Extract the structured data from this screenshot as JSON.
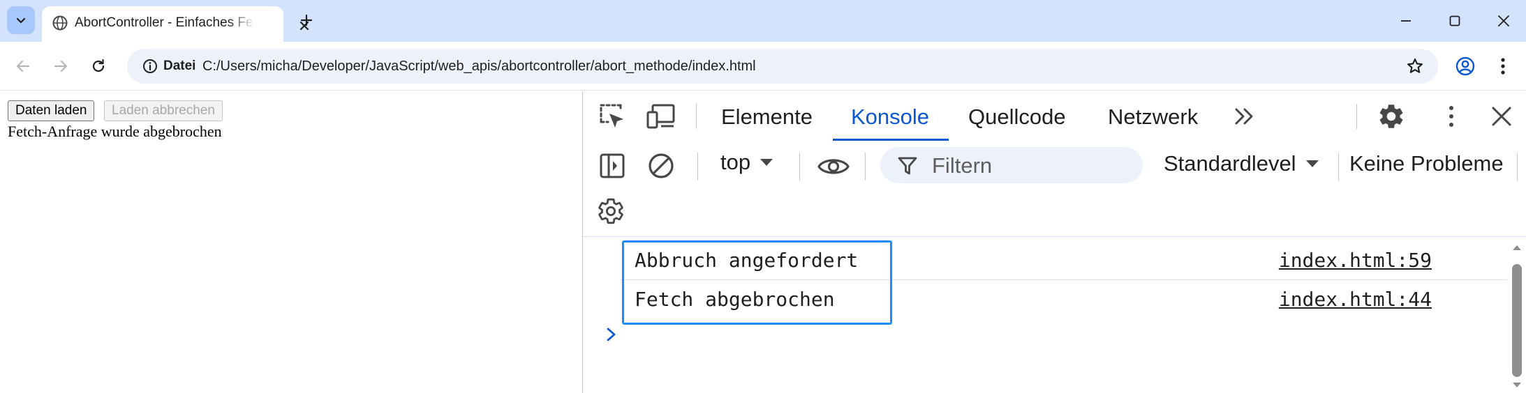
{
  "browser": {
    "tab_title": "AbortController - Einfaches Fetch-Beispiel",
    "url_badge": "Datei",
    "url": "C:/Users/micha/Developer/JavaScript/web_apis/abortcontroller/abort_methode/index.html"
  },
  "page": {
    "load_button": "Daten laden",
    "abort_button": "Laden abbrechen",
    "status": "Fetch-Anfrage wurde abgebrochen"
  },
  "devtools": {
    "tabs": [
      "Elemente",
      "Konsole",
      "Quellcode",
      "Netzwerk"
    ],
    "context": "top",
    "filter_placeholder": "Filtern",
    "levels": "Standardlevel",
    "issues": "Keine Probleme",
    "console_messages": [
      {
        "text": "Abbruch angefordert",
        "source": "index.html:59"
      },
      {
        "text": "Fetch abgebrochen",
        "source": "index.html:44"
      }
    ]
  },
  "colors": {
    "titlebar": "#d3e3fd",
    "accent": "#0b57d0",
    "highlight": "#1a8cff"
  }
}
